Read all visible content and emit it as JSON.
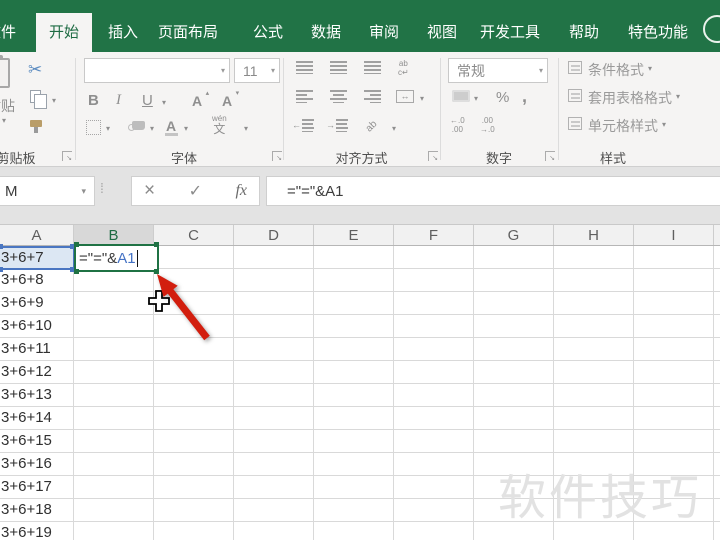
{
  "tabs": {
    "items": [
      {
        "label": "文件",
        "active": false
      },
      {
        "label": "开始",
        "active": true
      },
      {
        "label": "插入",
        "active": false
      },
      {
        "label": "页面布局",
        "active": false
      },
      {
        "label": "公式",
        "active": false
      },
      {
        "label": "数据",
        "active": false
      },
      {
        "label": "审阅",
        "active": false
      },
      {
        "label": "视图",
        "active": false
      },
      {
        "label": "开发工具",
        "active": false
      },
      {
        "label": "帮助",
        "active": false
      },
      {
        "label": "特色功能",
        "active": false
      }
    ]
  },
  "ribbon": {
    "clipboard": {
      "label": "剪贴板",
      "paste_label": "粘贴"
    },
    "font": {
      "label": "字体",
      "size": "11",
      "bold": "B",
      "italic": "I",
      "underline": "U",
      "phonetic_top": "wén",
      "phonetic": "文"
    },
    "alignment": {
      "label": "对齐方式",
      "wrap_text": "ab\nc↵",
      "orientation": "ab",
      "merge_arrow": "↔"
    },
    "number": {
      "label": "数字",
      "format": "常规",
      "percent": "%",
      "comma": ",",
      "inc_decimal": "←.0\n.00",
      "dec_decimal": ".00\n→.0"
    },
    "styles": {
      "label": "样式",
      "buttons": [
        "条件格式",
        "套用表格格式",
        "单元格样式"
      ]
    }
  },
  "formula_bar": {
    "name_box": "M",
    "formula": "=\"=\"&A1"
  },
  "grid": {
    "columns": [
      "A",
      "B",
      "C",
      "D",
      "E",
      "F",
      "G",
      "H",
      "I"
    ],
    "selected_column": "B",
    "col_a_values": [
      "3+6+7",
      "3+6+8",
      "3+6+9",
      "3+6+10",
      "3+6+11",
      "3+6+12",
      "3+6+13",
      "3+6+14",
      "3+6+15",
      "3+6+16",
      "3+6+17",
      "3+6+18",
      "3+6+19"
    ],
    "active_cell": {
      "ref": "B1",
      "formula_prefix": "=\"=\"&",
      "formula_ref": "A1"
    }
  },
  "watermark": "软件技巧",
  "colors": {
    "excel_green": "#217346",
    "active_tab_text": "#1e6b43",
    "ref_blue": "#4472c4",
    "a1_fill": "#dce7f3",
    "arrow_red": "#d21e0e"
  }
}
